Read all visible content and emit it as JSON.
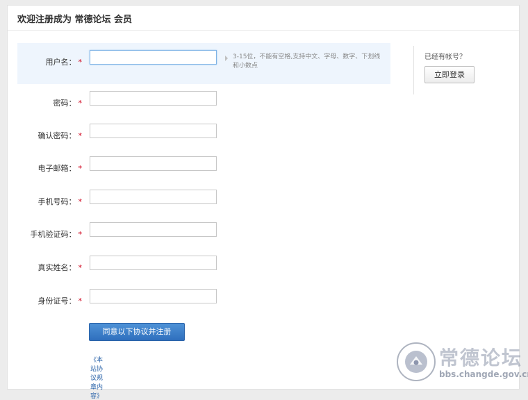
{
  "header": {
    "title": "欢迎注册成为 常德论坛 会员"
  },
  "form": {
    "username": {
      "label": "用户名：",
      "hint": "3-15位，不能有空格,支持中文、字母、数字、下划线和小数点"
    },
    "password": {
      "label": "密码："
    },
    "confirm_password": {
      "label": "确认密码："
    },
    "email": {
      "label": "电子邮箱："
    },
    "phone": {
      "label": "手机号码："
    },
    "phone_code": {
      "label": "手机验证码："
    },
    "real_name": {
      "label": "真实姓名："
    },
    "id_number": {
      "label": "身份证号："
    },
    "required_mark": "*",
    "submit_label": "同意以下协议并注册",
    "agreement_link": "《本站协议规章内容》"
  },
  "side": {
    "question": "已经有帐号？",
    "login_label": "立即登录"
  },
  "watermark": {
    "text": "常德论坛",
    "url": "bbs.changde.gov.cn",
    "seal_text": "常德论坛",
    "seal_url": "bbs.changde.gov.cn"
  },
  "colors": {
    "accent": "#2f6fbd",
    "required": "#d0021b",
    "highlight": "#eef5fd"
  }
}
